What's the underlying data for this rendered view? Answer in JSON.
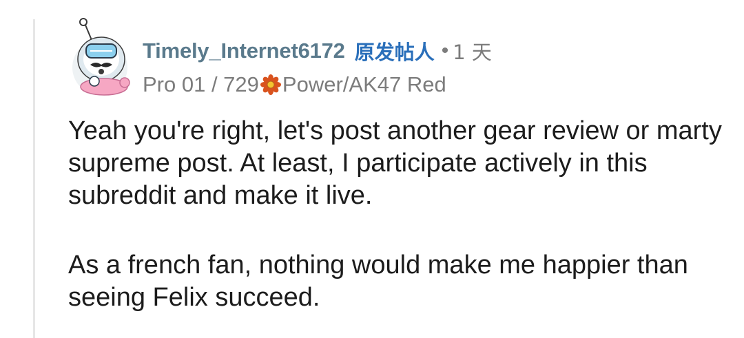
{
  "comment": {
    "author": {
      "username": "Timely_Internet6172",
      "op_label": "原发帖人",
      "separator": "•",
      "timestamp": "1 天",
      "flair_prefix": "Pro 01 / 729",
      "flair_icon": "flower-icon",
      "flair_suffix": "Power/AK47 Red"
    },
    "paragraphs": [
      "Yeah you're right, let's post another gear review or marty supreme post. At least, I participate actively in this subreddit and make it live.",
      "As a french fan, nothing would make me happier than seeing Felix succeed."
    ]
  },
  "colors": {
    "username": "#5a7a8c",
    "op_badge": "#2a6fba",
    "meta": "#7c7c7c",
    "body_text": "#1c1c1c",
    "thread_line": "#e6e6e6",
    "flair_icon": "#d9531e"
  }
}
